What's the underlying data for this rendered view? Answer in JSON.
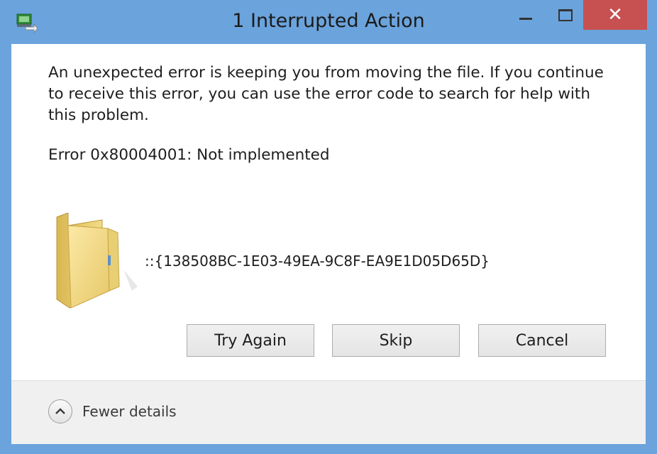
{
  "window": {
    "title": "1 Interrupted Action",
    "close_glyph": "✕"
  },
  "dialog": {
    "message": "An unexpected error is keeping you from moving the file. If you continue to receive this error, you can use the error code to search for help with this problem.",
    "error_line": "Error 0x80004001: Not implemented",
    "item_name": "::{138508BC-1E03-49EA-9C8F-EA9E1D05D65D}"
  },
  "buttons": {
    "try_again": "Try Again",
    "skip": "Skip",
    "cancel": "Cancel"
  },
  "footer": {
    "details_label": "Fewer details"
  },
  "colors": {
    "titlebar": "#6ba3dc",
    "close_button": "#c75050"
  },
  "icons": [
    "file-move-app-icon",
    "minimize-icon",
    "maximize-icon",
    "close-icon",
    "folder-icon",
    "chevron-up-icon"
  ]
}
